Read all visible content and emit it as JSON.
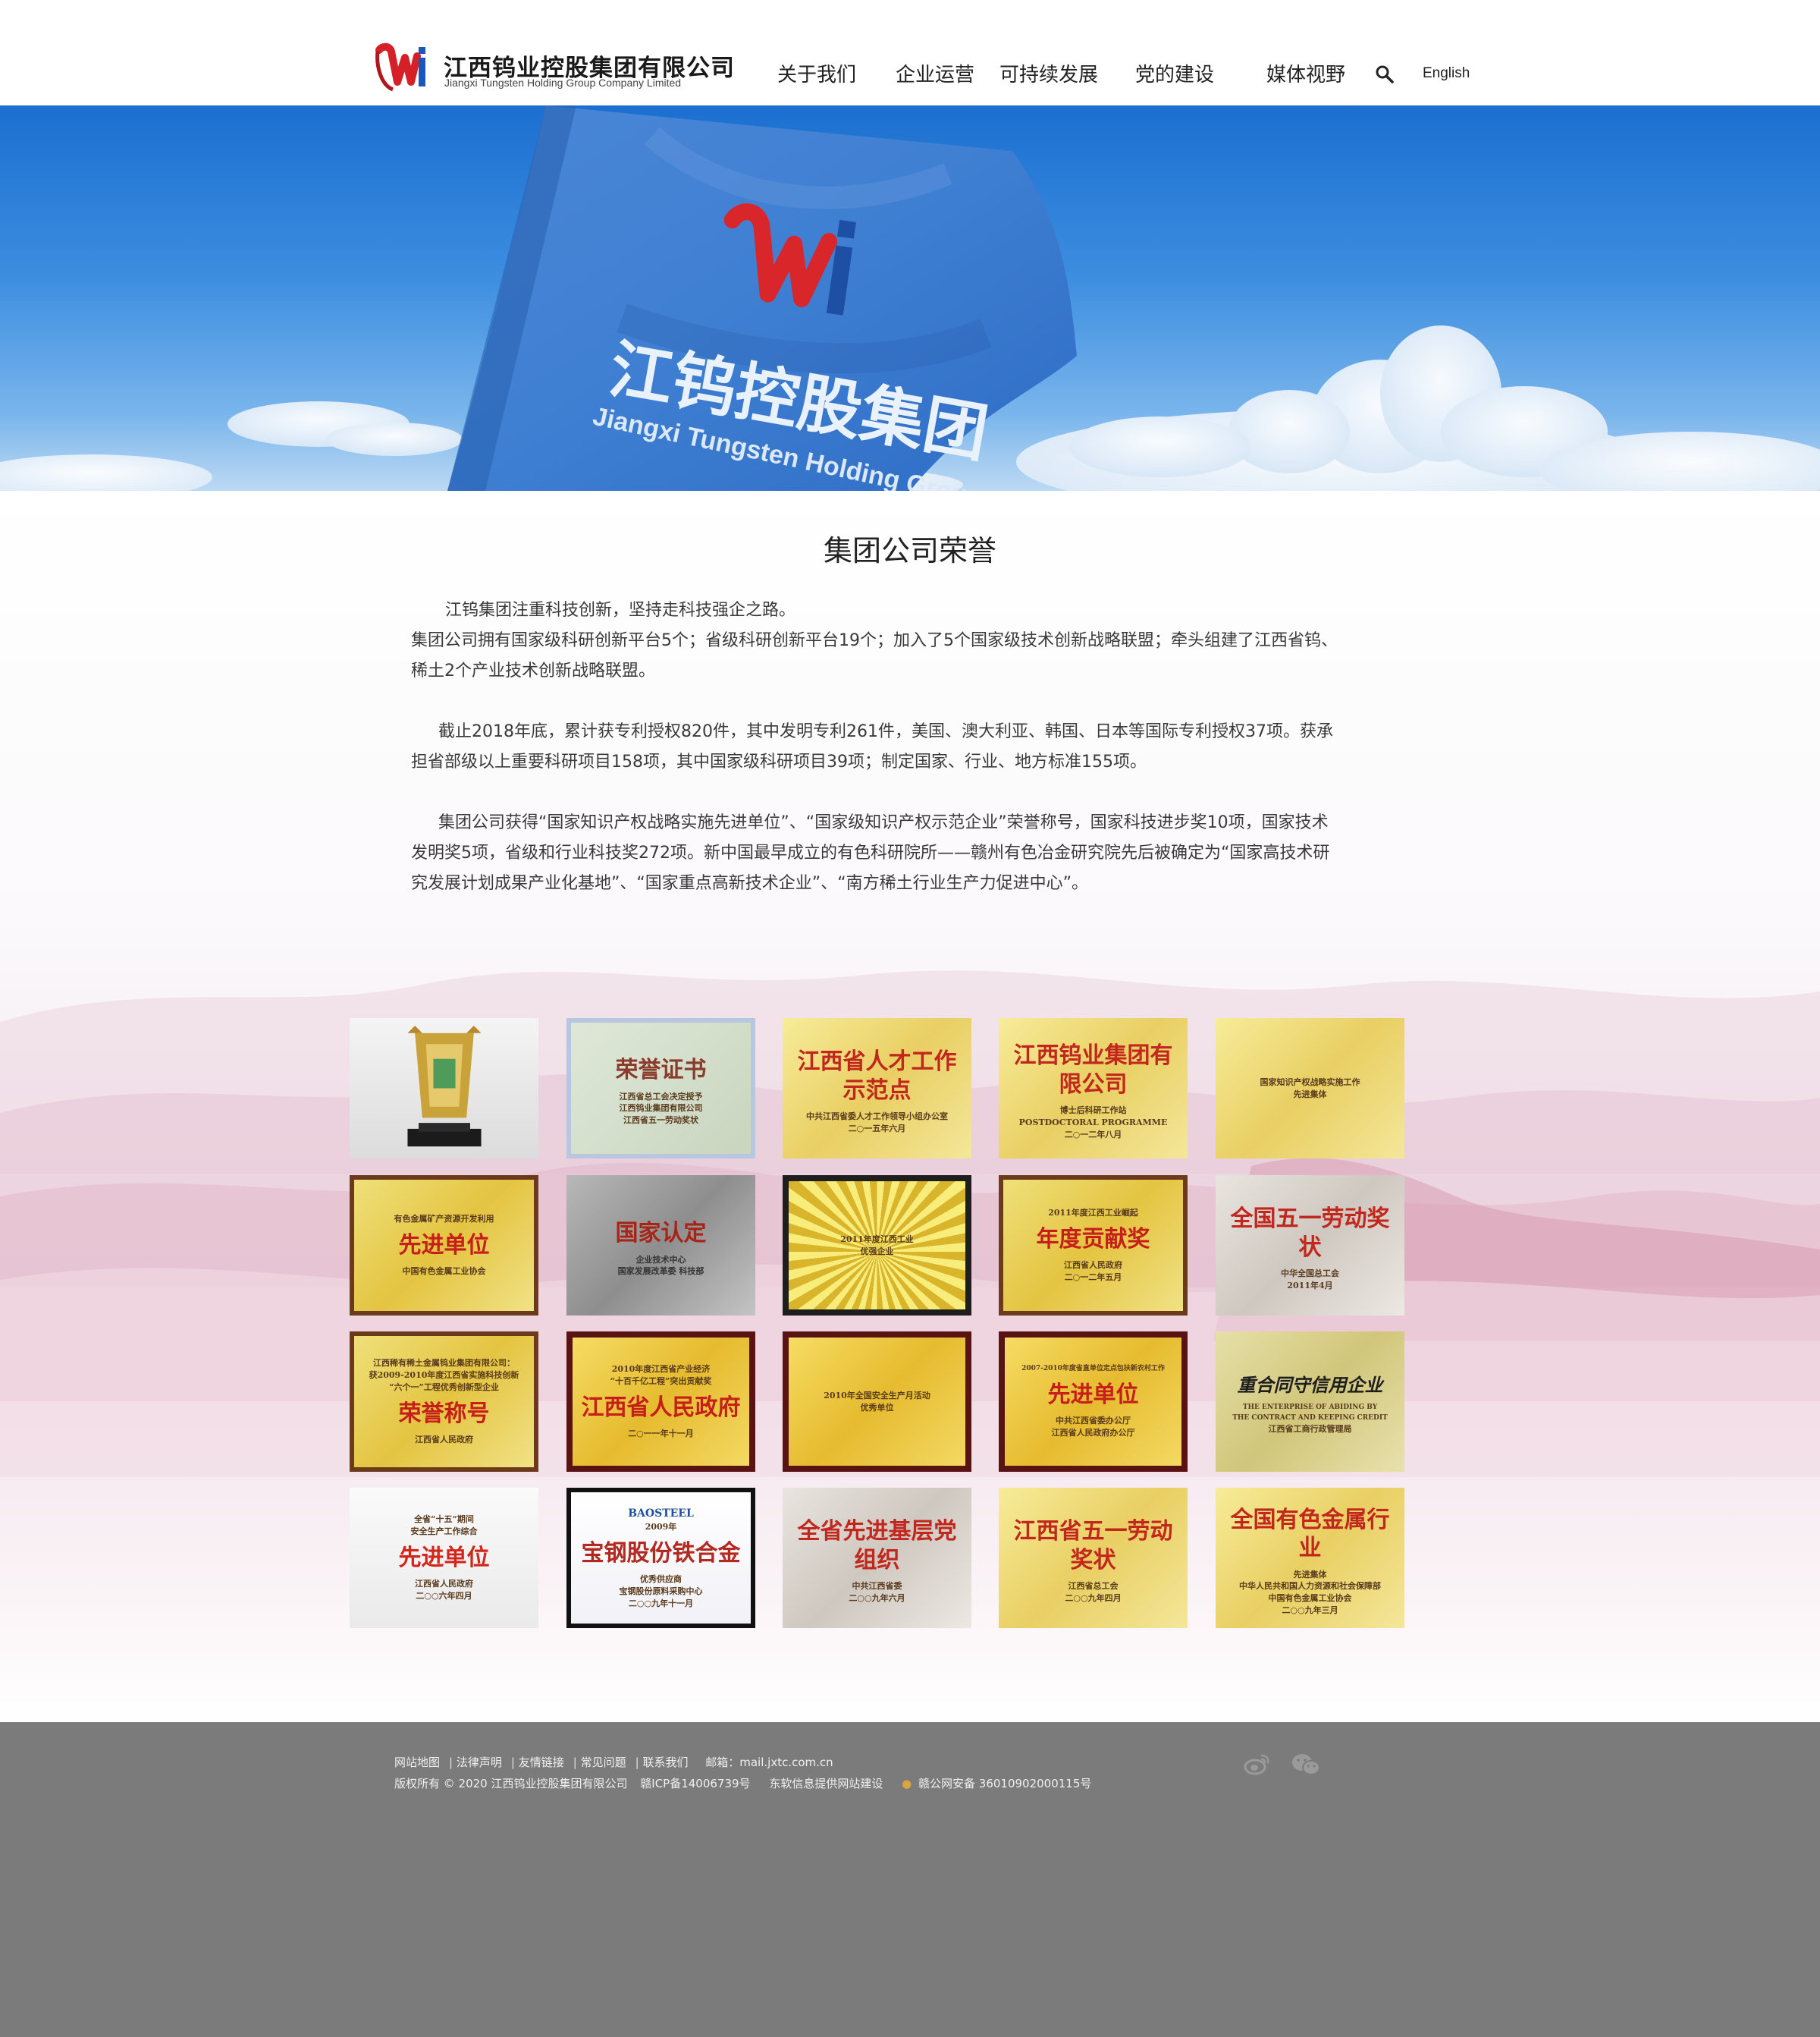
{
  "header": {
    "logo_cn": "江西钨业控股集团有限公司",
    "logo_en": "Jiangxi Tungsten Holding Group Company Limited",
    "nav": [
      "关于我们",
      "企业运营",
      "可持续发展",
      "党的建设",
      "媒体视野"
    ],
    "lang": "English"
  },
  "banner": {
    "flag_cn": "江钨控股集团",
    "flag_en": "Jiangxi Tungsten Holding Group"
  },
  "main": {
    "title": "集团公司荣誉",
    "paragraphs": [
      "江钨集团注重科技创新，坚持走科技强企之路。",
      "集团公司拥有国家级科研创新平台5个；省级科研创新平台19个；加入了5个国家级技术创新战略联盟；牵头组建了江西省钨、稀土2个产业技术创新战略联盟。",
      "截止2018年底，累计获专利授权820件，其中发明专利261件，美国、澳大利亚、韩国、日本等国际专利授权37项。获承担省部级以上重要科研项目158项，其中国家级科研项目39项；制定国家、行业、地方标准155项。",
      "集团公司获得“国家知识产权战略实施先进单位”、“国家级知识产权示范企业”荣誉称号，国家科技进步奖10项，国家技术发明奖5项，省级和行业科技奖272项。新中国最早成立的有色科研院所——赣州有色冶金研究院先后被确定为“国家高技术研究发展计划成果产业化基地”、“国家重点高新技术企业”、“南方稀土行业生产力促进中心”。"
    ]
  },
  "awards": [
    {
      "lines": [
        ""
      ],
      "style": "trophy"
    },
    {
      "lines": [
        "荣誉证书",
        "江西省总工会决定授予",
        "江西钨业集团有限公司",
        "江西省五一劳动奖状"
      ],
      "style": "cert"
    },
    {
      "lines": [
        "江西省人才工作示范点",
        "中共江西省委人才工作领导小组办公室",
        "二○一五年六月"
      ],
      "style": "gold-red"
    },
    {
      "lines": [
        "江西钨业集团有限公司",
        "博士后科研工作站",
        "POSTDOCTORAL PROGRAMME",
        "二○一二年八月"
      ],
      "style": "gold-red"
    },
    {
      "lines": [
        "国家知识产权战略实施工作",
        "先进集体"
      ],
      "style": "gold-red"
    },
    {
      "lines": [
        "有色金属矿产资源开发利用",
        "先进单位",
        "中国有色金属工业协会"
      ],
      "style": "gold-dark"
    },
    {
      "lines": [
        "国家认定",
        "企业技术中心",
        "国家发展改革委 科技部"
      ],
      "style": "silver"
    },
    {
      "lines": [
        "2011年度江西工业",
        "优强企业"
      ],
      "style": "ray"
    },
    {
      "lines": [
        "2011年度江西工业崛起",
        "年度贡献奖",
        "江西省人民政府",
        "二○一二年五月"
      ],
      "style": "gold-dark"
    },
    {
      "lines": [
        "全国五一劳动奖状",
        "中华全国总工会",
        "2011年4月"
      ],
      "style": "silver-red"
    },
    {
      "lines": [
        "江西稀有稀土金属钨业集团有限公司：",
        "获2009-2010年度江西省实施科技创新",
        "“六个一”工程优秀创新型企业",
        "荣誉称号",
        "江西省人民政府"
      ],
      "style": "gold-dark"
    },
    {
      "lines": [
        "2010年度江西省产业经济",
        "“十百千亿工程”突出贡献奖",
        "江西省人民政府",
        "二○一一年十一月"
      ],
      "style": "gold-maroon"
    },
    {
      "lines": [
        "2010年全国安全生产月活动",
        "优秀单位"
      ],
      "style": "gold-maroon"
    },
    {
      "lines": [
        "2007-2010年度省直单位定点包扶新农村工作",
        "先进单位",
        "中共江西省委办公厅",
        "江西省人民政府办公厅"
      ],
      "style": "gold-maroon"
    },
    {
      "lines": [
        "重合同守信用企业",
        "THE ENTERPRISE OF ABIDING BY",
        "THE CONTRACT AND KEEPING CREDIT",
        "江西省工商行政管理局"
      ],
      "style": "gold-plain"
    },
    {
      "lines": [
        "全省“十五”期间",
        "安全生产工作综合",
        "先进单位",
        "江西省人民政府",
        "二○○六年四月"
      ],
      "style": "white-red"
    },
    {
      "lines": [
        "BAOSTEEL",
        "2009年",
        "宝钢股份铁合金",
        "优秀供应商",
        "宝钢股份原料采购中心",
        "二○○九年十一月"
      ],
      "style": "white-blue"
    },
    {
      "lines": [
        "全省先进基层党组织",
        "中共江西省委",
        "二○○九年六月"
      ],
      "style": "silver-red"
    },
    {
      "lines": [
        "江西省五一劳动奖状",
        "江西省总工会",
        "二○○九年四月"
      ],
      "style": "gold-red"
    },
    {
      "lines": [
        "全国有色金属行业",
        "先进集体",
        "中华人民共和国人力资源和社会保障部",
        "中国有色金属工业协会",
        "二○○九年三月"
      ],
      "style": "gold-red"
    }
  ],
  "footer": {
    "links": [
      "网站地图",
      "法律声明",
      "友情链接",
      "常见问题",
      "联系我们"
    ],
    "email_label": "邮箱：",
    "email": "mail.jxtc.com.cn",
    "copyright": "版权所有 © 2020 江西钨业控股集团有限公司",
    "icp": "赣ICP备14006739号",
    "builder": "东软信息提供网站建设",
    "police": "赣公网安备 36010902000115号"
  }
}
